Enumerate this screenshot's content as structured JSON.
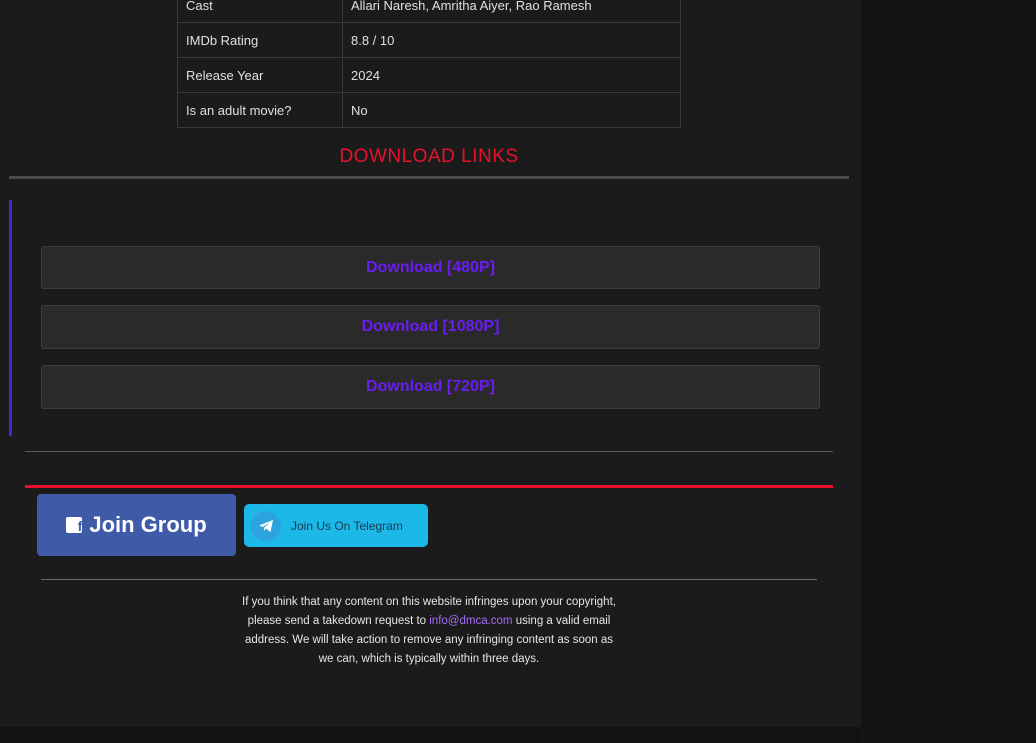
{
  "info_table": [
    {
      "key": "Cast",
      "value": "Allari Naresh, Amritha Aiyer, Rao Ramesh"
    },
    {
      "key": "IMDb Rating",
      "value": "8.8 / 10"
    },
    {
      "key": "Release Year",
      "value": "2024"
    },
    {
      "key": "Is an adult movie?",
      "value": "No"
    }
  ],
  "download_heading": "DOWNLOAD LINKS",
  "downloads": [
    {
      "label": "Download [480P]"
    },
    {
      "label": "Download [1080P]"
    },
    {
      "label": "Download [720P]"
    }
  ],
  "join_group": {
    "label": "Join Group",
    "icon": "facebook-icon"
  },
  "telegram": {
    "label": "Join Us On Telegram",
    "icon": "telegram-icon"
  },
  "dmca": {
    "before": "If you think that any content on this website infringes upon your copyright, please send a takedown request to",
    "email": "info@dmca.com",
    "after": "using a valid email address. We will take action to remove any infringing content as soon as we can, which is typically within three days."
  },
  "colors": {
    "accent_red": "#e8112d",
    "download_text": "#6a1cf2",
    "link": "#a56cf5",
    "telegram": "#1cb8e8"
  }
}
